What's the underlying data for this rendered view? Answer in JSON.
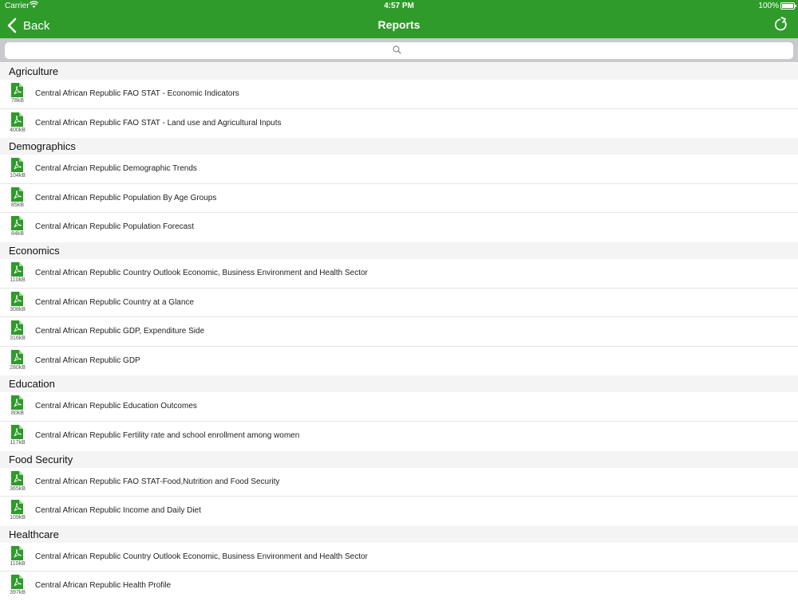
{
  "status": {
    "carrier": "Carrier",
    "time": "4:57 PM",
    "battery": "100%"
  },
  "nav": {
    "back_label": "Back",
    "title": "Reports"
  },
  "colors": {
    "accent": "#2e9b2a",
    "section_bg": "#f4f4f4",
    "search_bar_bg": "#c9c9ce"
  },
  "sections": [
    {
      "title": "Agriculture",
      "items": [
        {
          "size": "78kB",
          "label": "Central African Republic FAO STAT - Economic Indicators"
        },
        {
          "size": "400kB",
          "label": "Central African Republic FAO STAT - Land use and Agricultural Inputs"
        }
      ]
    },
    {
      "title": "Demographics",
      "items": [
        {
          "size": "104kB",
          "label": "Central Afrcian Republic Demographic Trends"
        },
        {
          "size": "85kB",
          "label": "Central African Republic Population By Age Groups"
        },
        {
          "size": "84kB",
          "label": "Central African Republic Population Forecast"
        }
      ]
    },
    {
      "title": "Economics",
      "items": [
        {
          "size": "110kB",
          "label": "Central African Republic Country Outlook Economic, Business Environment and Health Sector"
        },
        {
          "size": "308kB",
          "label": "Central African Republic Country at a Glance"
        },
        {
          "size": "316kB",
          "label": "Central African Republic GDP, Expenditure Side"
        },
        {
          "size": "280kB",
          "label": "Central African Republic GDP"
        }
      ]
    },
    {
      "title": "Education",
      "items": [
        {
          "size": "80kB",
          "label": "Central African Republic Education Outcomes"
        },
        {
          "size": "117kB",
          "label": "Central African Republic Fertility rate and school enrollment among women"
        }
      ]
    },
    {
      "title": "Food Security",
      "items": [
        {
          "size": "365kB",
          "label": "Central African Republic FAO STAT-Food,Nutrition and Food Security"
        },
        {
          "size": "109kB",
          "label": "Central African Republic Income and Daily Diet"
        }
      ]
    },
    {
      "title": "Healthcare",
      "items": [
        {
          "size": "110kB",
          "label": "Central African Republic Country Outlook Economic, Business Environment and Health Sector"
        },
        {
          "size": "397kB",
          "label": "Central African Republic Health Profile"
        }
      ]
    }
  ]
}
